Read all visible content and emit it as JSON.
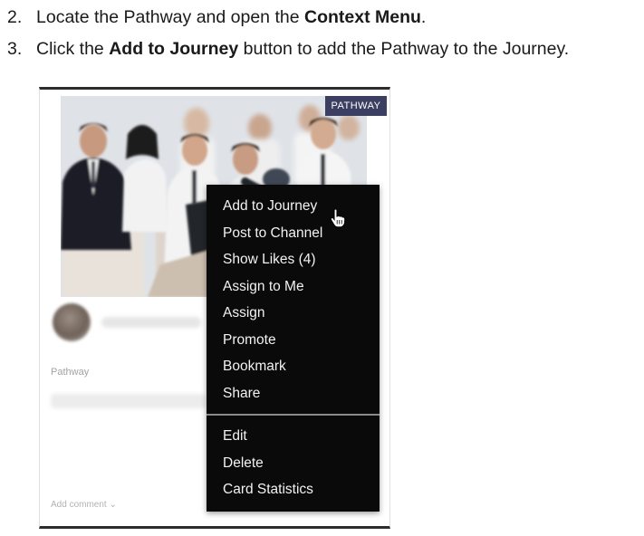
{
  "instructions": {
    "step2": {
      "number": "2.",
      "text_before": "Locate the Pathway and open the ",
      "bold": "Context Menu",
      "text_after": "."
    },
    "step3": {
      "number": "3.",
      "text_before": "Click the ",
      "bold": "Add to Journey",
      "text_after": " button to add the Pathway to the Journey."
    }
  },
  "card": {
    "badge": "PATHWAY",
    "type_label": "Pathway",
    "add_comment": "Add comment ⌄"
  },
  "context_menu": {
    "items": [
      "Add to Journey",
      "Post to Channel",
      "Show Likes (4)",
      "Assign to Me",
      "Assign",
      "Promote",
      "Bookmark",
      "Share"
    ],
    "secondary_items": [
      "Edit",
      "Delete",
      "Card Statistics"
    ]
  },
  "colors": {
    "badge_bg": "#3c3f62",
    "menu_bg": "#0a0a0a",
    "menu_text": "#f2f2f2"
  },
  "icons": [
    "hand-pointer-cursor-icon"
  ]
}
